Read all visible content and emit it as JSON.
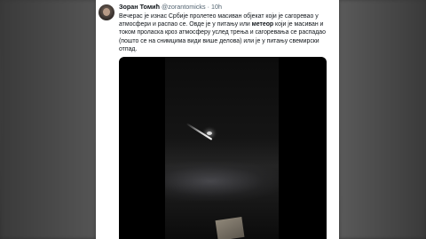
{
  "tweet": {
    "author_name": "Зоран Томић",
    "handle": "@zorantomicks",
    "separator": "·",
    "time": "10h",
    "text_part1": "Вечерас је изнас Србије пролетео масиван објекат који је сагоревао у атмосфери и распао се. Овде је у питању или ",
    "text_bold": "метеор",
    "text_part2": " који је масиван и током проласка кроз атмосферу услед трења и сагоревања се распадао (пошто се на снимцима види више делова) или је у питању свемирски отпад."
  },
  "media": {
    "type": "video",
    "content": "meteor-streak-night-sky"
  }
}
